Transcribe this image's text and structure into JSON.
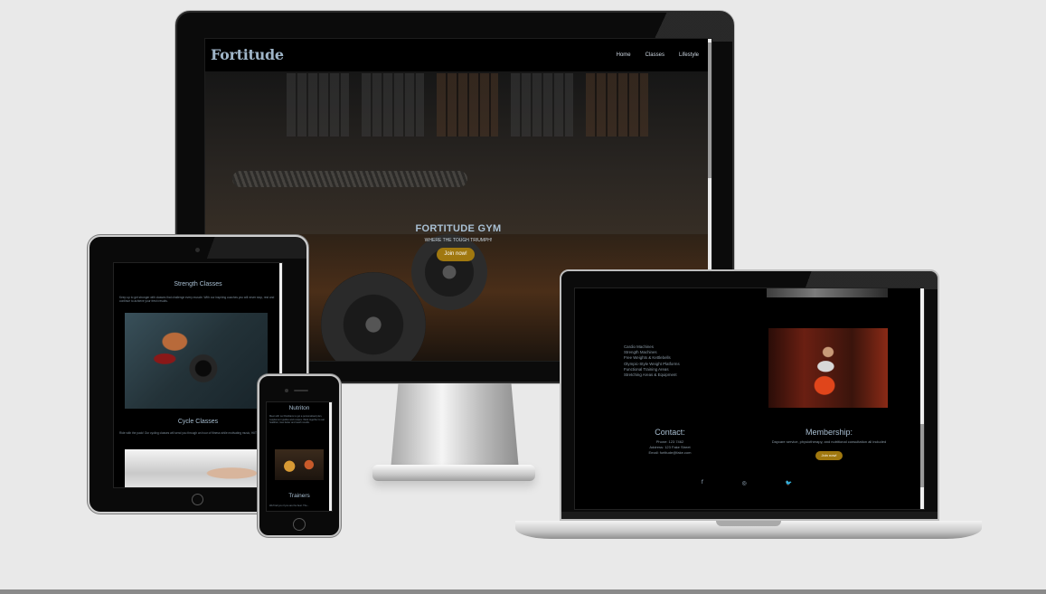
{
  "desktop": {
    "logo": "Fortitude",
    "nav": [
      "Home",
      "Classes",
      "Lifestyle"
    ],
    "hero_title": "FORTITUDE GYM",
    "hero_subtitle": "WHERE THE TOUGH TRIUMPH!",
    "join_button": "Join now!"
  },
  "tablet": {
    "section1_title": "Strength Classes",
    "section1_text": "Keep up to get stronger with classes that challenge every muscle. With our inspiring coaches you will never stop, rest and continue to achieve your fresh results.",
    "section2_title": "Cycle Classes",
    "section2_text": "Ride with the pack! Our cycling classes will send you through an hour of fitness while motivating music, HIIT and drills."
  },
  "phone": {
    "title": "Nutriton",
    "text": "Meet with our Dietitians to get a personalised plan, supplement guides and recipes. Work together to eat healthier, lose better and reach results.",
    "trainers_title": "Trainers",
    "trainers_text": "We'll tell you if you are the best. The..."
  },
  "laptop": {
    "facilities": [
      "Cardio Machines",
      "Strength Machines",
      "Free Weights & Kettlebells",
      "Olympic-Style Weight Platforms",
      "Functional Training Areas",
      "Stretching Areas & Equipment"
    ],
    "contact_title": "Contact:",
    "contact_phone": "Phone: 123 7462",
    "contact_address": "Address: 123 Fake Street",
    "contact_email": "Email: fortitude@fake.com",
    "membership_title": "Membership:",
    "membership_text": "Daycare service, physiotherapy, and nutritional consultation all included",
    "join_button": "Join now!",
    "social": [
      "f",
      "◎",
      "🐦"
    ]
  }
}
